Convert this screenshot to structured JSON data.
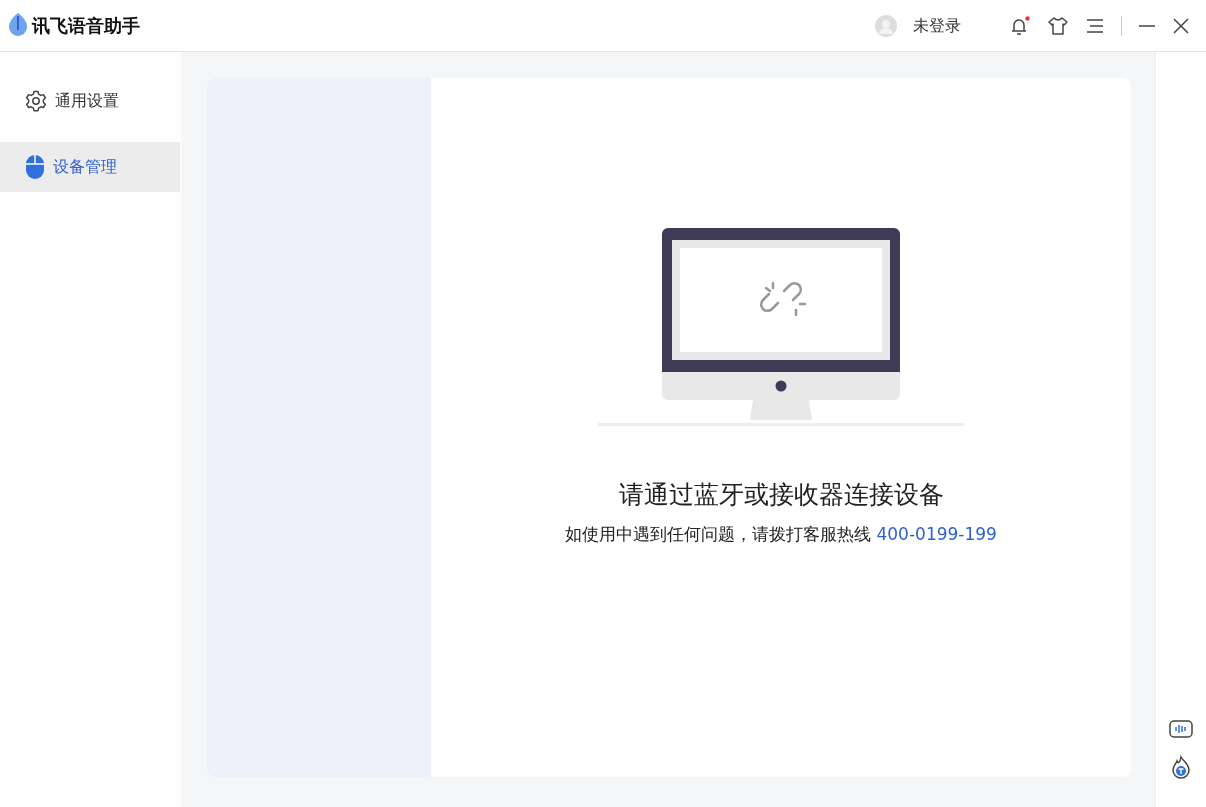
{
  "app": {
    "title": "讯飞语音助手"
  },
  "user": {
    "label": "未登录"
  },
  "notifications": {
    "unread": true
  },
  "sidebar": {
    "items": [
      {
        "label": "通用设置",
        "kind": "gear",
        "selected": false
      },
      {
        "label": "设备管理",
        "kind": "mouse",
        "selected": true
      }
    ]
  },
  "empty_state": {
    "title": "请通过蓝牙或接收器连接设备",
    "message": "如使用中遇到任何问题，请拨打客服热线",
    "hotline": "400-0199-199"
  }
}
